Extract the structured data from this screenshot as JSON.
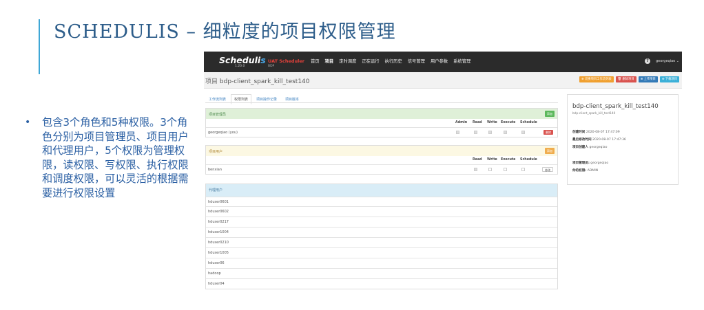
{
  "slide": {
    "title": "SCHEDULIS – 细粒度的项目权限管理",
    "bullet_marker": "•",
    "bullet_text": "包含3个角色和5种权限。3个角色分别为项目管理员、项目用户和代理用户，5个权限为管理权限，读权限、写权限、执行权限和调度权限，可以灵活的根据需要进行权限设置"
  },
  "colors": {
    "accent_bar": "#3fa7d6",
    "title": "#2d5d8a",
    "bullet": "#2a5fa3",
    "nav_bg": "#2b2b2b",
    "env_red": "#e8413a"
  },
  "app": {
    "logo_main": "Scheduli",
    "logo_s": "s",
    "version": "1.20.0",
    "env": "UAT Scheduler",
    "env_sub": "BDP",
    "menu": [
      "首页",
      "项目",
      "定时调度",
      "正在运行",
      "执行历史",
      "信号管理",
      "用户参数",
      "系统管理"
    ],
    "help_icon": "?",
    "user": "georgeqiao ⌄"
  },
  "project": {
    "prefix": "项目",
    "name": "bdp-client_spark_kill_test140",
    "buttons": [
      "⊕ 切换项目工作流列表",
      "🗑 删除项目",
      "⊕ 上传项目",
      "⊕ 下载项目"
    ]
  },
  "tabs": [
    "工作流列表",
    "权限列表",
    "项目操作记录",
    "项目版本"
  ],
  "permissions": {
    "admin_panel": {
      "title": "项目管理员",
      "add": "添加",
      "columns": [
        "Admin",
        "Read",
        "Write",
        "Execute",
        "Schedule"
      ],
      "rows": [
        {
          "name": "georgeqiao (you)",
          "action": "删除"
        }
      ]
    },
    "user_panel": {
      "title": "项目用户",
      "add": "添加",
      "columns": [
        "Read",
        "Write",
        "Execute",
        "Schedule"
      ],
      "rows": [
        {
          "name": "benxian",
          "action": "修改"
        }
      ]
    },
    "proxy_panel": {
      "title": "代理用户",
      "rows": [
        "hduser0601",
        "hduser0602",
        "hduser0217",
        "hduser1004",
        "hduser0210",
        "hduser1005",
        "hduser06",
        "hadoop",
        "hduser04"
      ]
    }
  },
  "info": {
    "name": "bdp-client_spark_kill_test140",
    "sub": "bdp-client_spark_kill_test140",
    "created_label": "创建时间",
    "created": "2020-08-07 17:47:09",
    "modified_label": "最后修改时间",
    "modified": "2020-08-07 17:47:36",
    "creator_label": "项目创建人",
    "creator": "georgeqiao",
    "admin_label": "项目管理员:",
    "admin": "georgeqiao",
    "perm_label": "你的权限:",
    "perm": "ADMIN"
  }
}
